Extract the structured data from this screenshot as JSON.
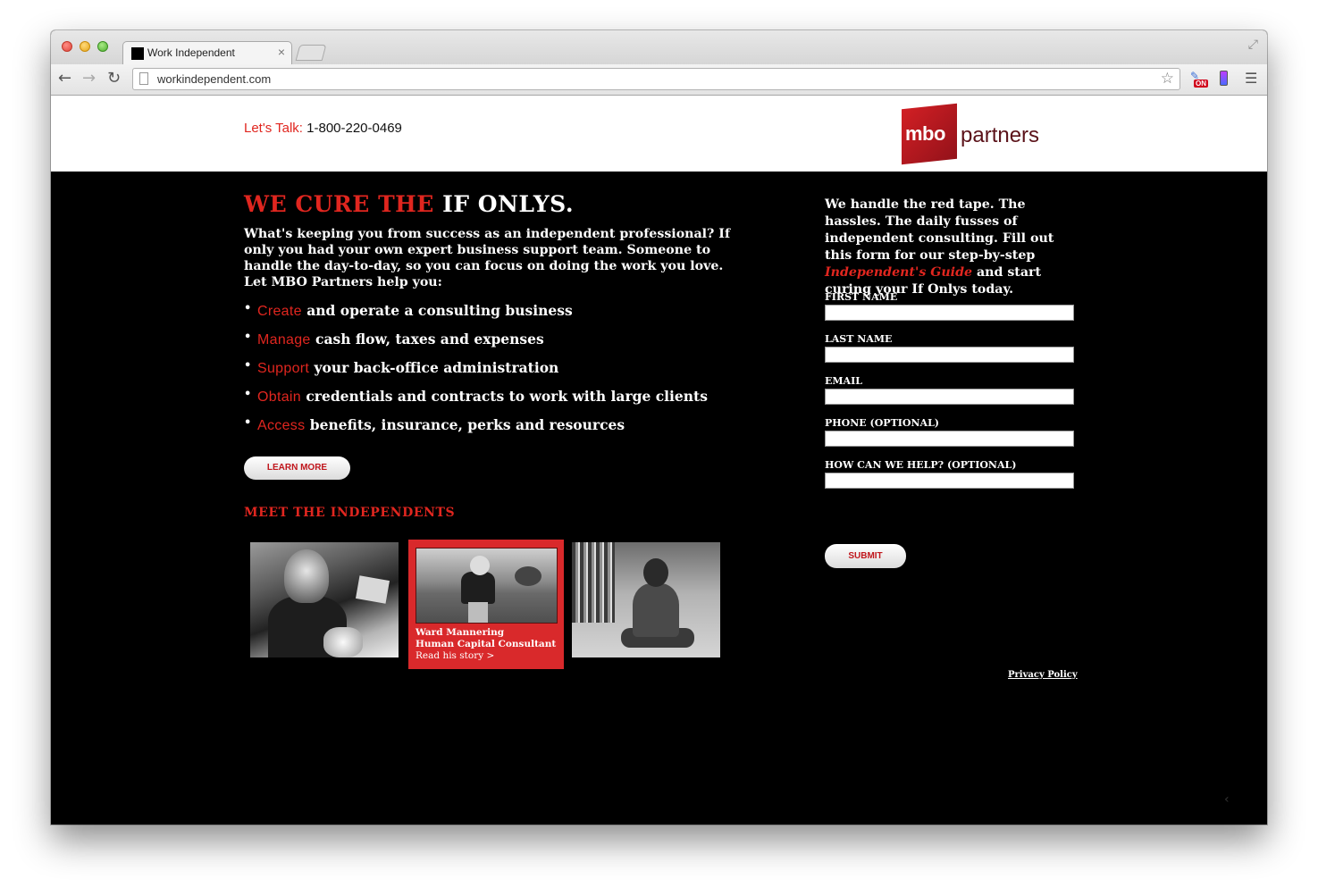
{
  "browser": {
    "tab_title": "Work Independent",
    "tab_close": "×",
    "url": "workindependent.com",
    "nav": {
      "back": "←",
      "forward": "→",
      "reload": "↻"
    },
    "star": "☆",
    "menu": "☰",
    "ext_badge": "ON",
    "fullscreen": "⤢"
  },
  "header": {
    "talk_label": "Let's Talk:",
    "phone": "1-800-220-0469",
    "logo_mbo": "mbo",
    "logo_partners": "partners"
  },
  "main": {
    "headline_red": "WE CURE THE",
    "headline_white": "IF ONLYS.",
    "intro": "What's keeping you from success as an independent professional? If only you had your own expert business support team. Someone to handle the day-to-day, so you can focus on doing the work you love. Let MBO Partners help you:",
    "benefits": [
      {
        "key": "Create",
        "rest": "and operate a consulting business"
      },
      {
        "key": "Manage",
        "rest": "cash flow, taxes and expenses"
      },
      {
        "key": "Support",
        "rest": "your back-office administration"
      },
      {
        "key": "Obtain",
        "rest": "credentials and contracts to work with large clients"
      },
      {
        "key": "Access",
        "rest": "benefits, insurance, perks and resources"
      }
    ],
    "learn_more": "LEARN MORE",
    "meet_heading": "MEET THE INDEPENDENTS",
    "featured": {
      "name": "Ward Mannering",
      "title": "Human Capital Consultant",
      "link": "Read his story >"
    }
  },
  "sidebar": {
    "copy_before": "We handle the red tape. The hassles. The daily fusses of independent consulting. Fill out this form for our step-by-step ",
    "guide": "Independent's Guide",
    "copy_after": " and start curing your If Onlys today.",
    "fields": [
      {
        "label": "FIRST NAME"
      },
      {
        "label": "LAST NAME"
      },
      {
        "label": "EMAIL"
      },
      {
        "label": "PHONE (OPTIONAL)"
      },
      {
        "label": "HOW CAN WE HELP? (OPTIONAL)"
      }
    ],
    "submit": "SUBMIT",
    "privacy": "Privacy Policy"
  },
  "colors": {
    "accent": "#e0261f",
    "background": "#000000",
    "brand_dark": "#5b1219"
  }
}
